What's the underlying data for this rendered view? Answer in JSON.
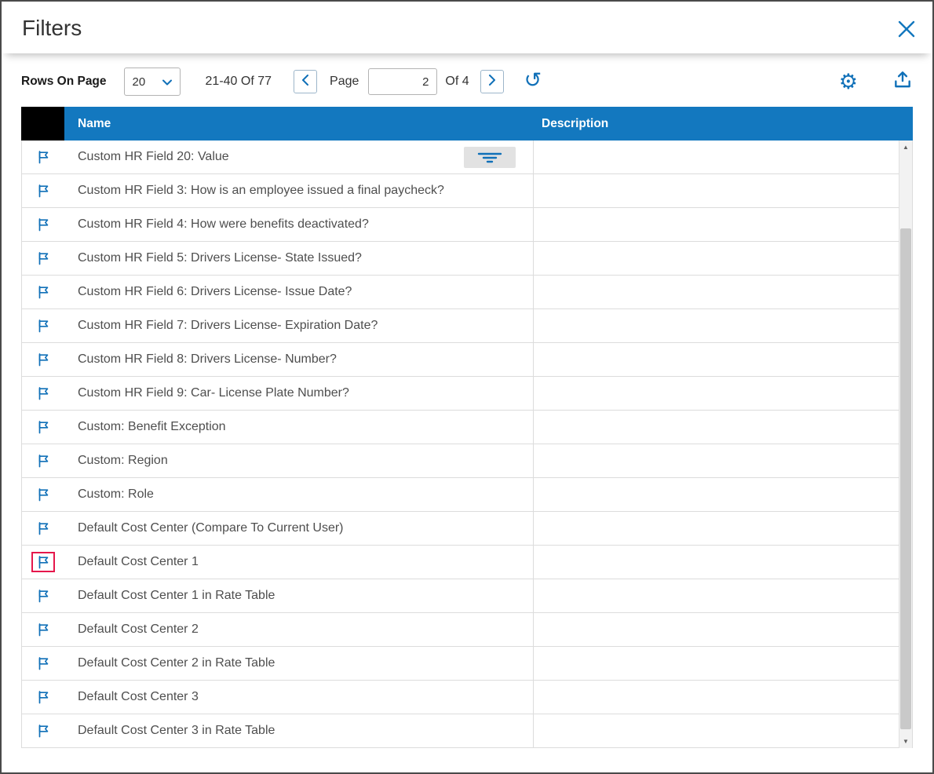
{
  "dialog": {
    "title": "Filters"
  },
  "toolbar": {
    "rows_on_page_label": "Rows On Page",
    "rows_per_page_value": "20",
    "range_text": "21-40 Of 77",
    "page_label": "Page",
    "page_value": "2",
    "of_label": "Of 4",
    "icons": {
      "prev": "chevron-left-icon",
      "next": "chevron-right-icon",
      "refresh": "refresh-icon",
      "settings": "gear-icon",
      "export": "export-icon"
    }
  },
  "table": {
    "columns": [
      "Name",
      "Description"
    ],
    "row_icon": "flag-icon",
    "rows": [
      {
        "name": "Custom HR Field 20: Value",
        "description": "",
        "has_filter_button": true
      },
      {
        "name": "Custom HR Field 3: How is an employee issued a final paycheck?",
        "description": ""
      },
      {
        "name": "Custom HR Field 4: How were benefits deactivated?",
        "description": ""
      },
      {
        "name": "Custom HR Field 5: Drivers License- State Issued?",
        "description": ""
      },
      {
        "name": "Custom HR Field 6: Drivers License- Issue Date?",
        "description": ""
      },
      {
        "name": "Custom HR Field 7: Drivers License- Expiration Date?",
        "description": ""
      },
      {
        "name": "Custom HR Field 8: Drivers License- Number?",
        "description": ""
      },
      {
        "name": "Custom HR Field 9: Car- License Plate Number?",
        "description": ""
      },
      {
        "name": "Custom: Benefit Exception",
        "description": ""
      },
      {
        "name": "Custom: Region",
        "description": ""
      },
      {
        "name": "Custom: Role",
        "description": ""
      },
      {
        "name": "Default Cost Center (Compare To Current User)",
        "description": ""
      },
      {
        "name": "Default Cost Center 1",
        "description": "",
        "flag_highlighted": true
      },
      {
        "name": "Default Cost Center 1 in Rate Table",
        "description": ""
      },
      {
        "name": "Default Cost Center 2",
        "description": ""
      },
      {
        "name": "Default Cost Center 2 in Rate Table",
        "description": ""
      },
      {
        "name": "Default Cost Center 3",
        "description": ""
      },
      {
        "name": "Default Cost Center 3 in Rate Table",
        "description": ""
      }
    ]
  },
  "colors": {
    "header_bg": "#1378bf",
    "accent_blue": "#1070b8",
    "highlight_red": "#e5174b",
    "row_border": "#dcdcdc",
    "text": "#4e4e4e"
  }
}
